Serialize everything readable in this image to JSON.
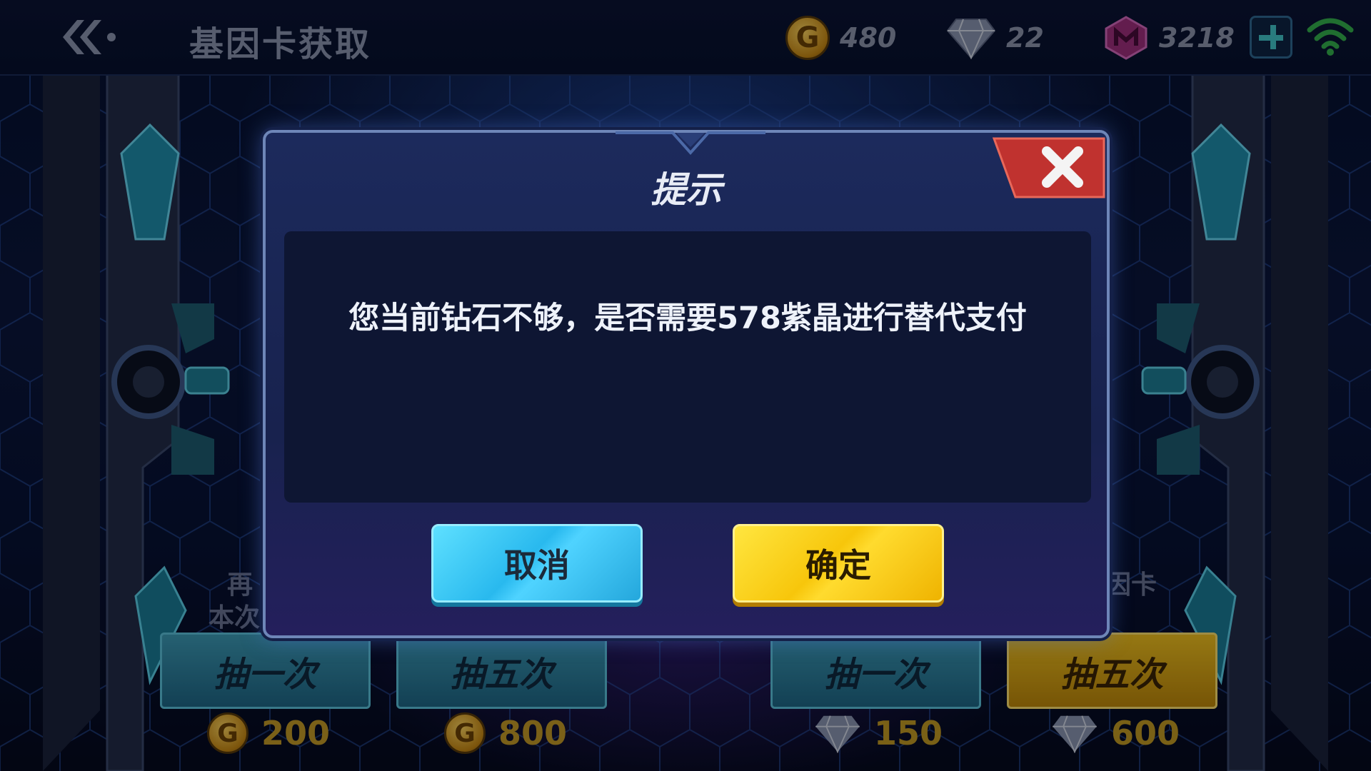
{
  "header": {
    "title": "基因卡获取",
    "gold": "480",
    "diamond": "22",
    "crystal": "3218"
  },
  "background": {
    "left_text_1": "再",
    "left_text_2": "本次",
    "right_text": "因卡",
    "buttons": [
      {
        "label": "抽一次",
        "price": "200",
        "currency": "gold"
      },
      {
        "label": "抽五次",
        "price": "800",
        "currency": "gold"
      },
      {
        "label": "抽一次",
        "price": "150",
        "currency": "diamond"
      },
      {
        "label": "抽五次",
        "price": "600",
        "currency": "diamond"
      }
    ]
  },
  "dialog": {
    "title": "提示",
    "message": "您当前钻石不够，是否需要578紫晶进行替代支付",
    "cancel_label": "取消",
    "confirm_label": "确定"
  },
  "icons": {
    "gold_coin_letter": "G"
  },
  "colors": {
    "cancel_button": "#29b9ee",
    "confirm_button": "#f7c60b",
    "close_button": "#c0322f",
    "crystal": "#a0307a"
  }
}
